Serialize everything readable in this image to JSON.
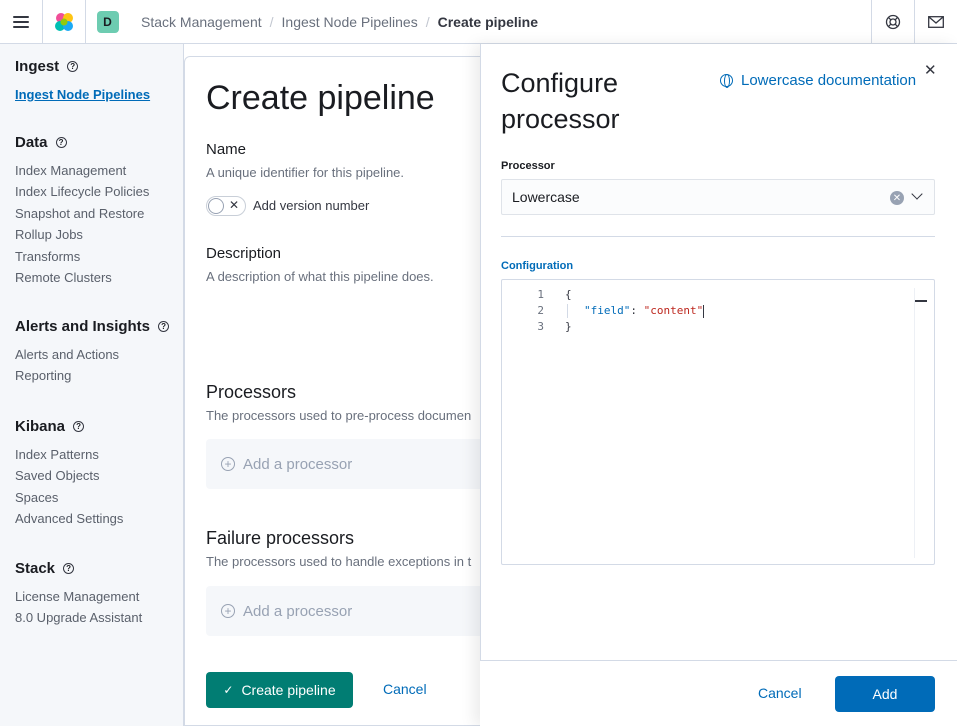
{
  "header": {
    "space_initial": "D",
    "breadcrumbs": [
      "Stack Management",
      "Ingest Node Pipelines",
      "Create pipeline"
    ]
  },
  "sidebar": {
    "sections": [
      {
        "title": "Ingest",
        "items": [
          "Ingest Node Pipelines"
        ]
      },
      {
        "title": "Data",
        "items": [
          "Index Management",
          "Index Lifecycle Policies",
          "Snapshot and Restore",
          "Rollup Jobs",
          "Transforms",
          "Remote Clusters"
        ]
      },
      {
        "title": "Alerts and Insights",
        "items": [
          "Alerts and Actions",
          "Reporting"
        ]
      },
      {
        "title": "Kibana",
        "items": [
          "Index Patterns",
          "Saved Objects",
          "Spaces",
          "Advanced Settings"
        ]
      },
      {
        "title": "Stack",
        "items": [
          "License Management",
          "8.0 Upgrade Assistant"
        ]
      }
    ]
  },
  "main": {
    "title": "Create pipeline",
    "name_label": "Name",
    "name_help": "A unique identifier for this pipeline.",
    "version_toggle_label": "Add version number",
    "description_label": "Description",
    "description_help": "A description of what this pipeline does.",
    "processors_title": "Processors",
    "processors_help": "The processors used to pre-process documen",
    "add_processor": "Add a processor",
    "failure_title": "Failure processors",
    "failure_help": "The processors used to handle exceptions in t",
    "add_failure_processor": "Add a processor",
    "create_button": "Create pipeline",
    "cancel_button": "Cancel"
  },
  "flyout": {
    "title": "Configure processor",
    "doc_link": "Lowercase documentation",
    "processor_label": "Processor",
    "processor_value": "Lowercase",
    "configuration_label": "Configuration",
    "editor": {
      "line_numbers": [
        "1",
        "2",
        "3"
      ],
      "line1": "{",
      "key": "\"field\"",
      "colon": ": ",
      "value": "\"content\"",
      "line3": "}"
    },
    "cancel_button": "Cancel",
    "add_button": "Add"
  }
}
